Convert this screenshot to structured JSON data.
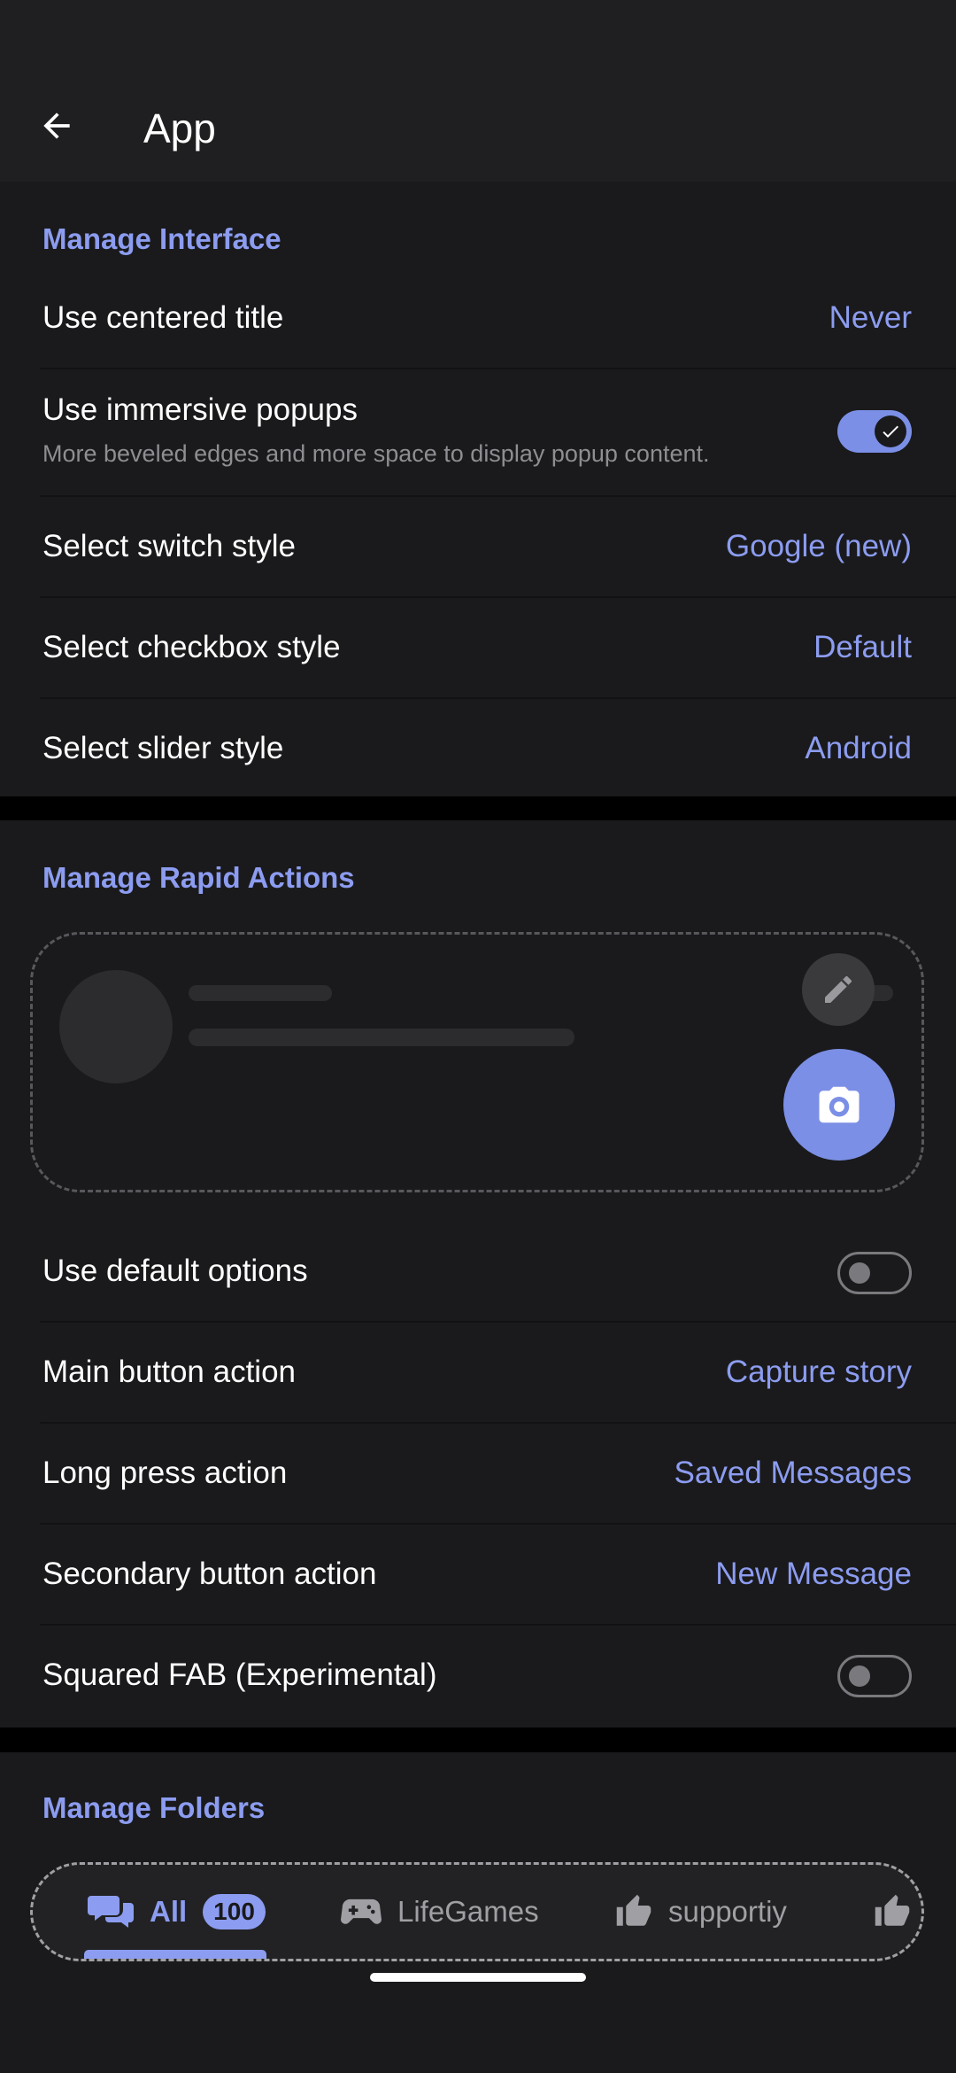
{
  "appbar": {
    "title": "App",
    "back_icon": "arrow-left-icon"
  },
  "manage_interface": {
    "header": "Manage Interface",
    "rows": [
      {
        "label": "Use centered title",
        "value": "Never"
      },
      {
        "label": "Use immersive popups",
        "subtitle": "More beveled edges and more space to display popup content.",
        "toggle": true
      },
      {
        "label": "Select switch style",
        "value": "Google (new)"
      },
      {
        "label": "Select checkbox style",
        "value": "Default"
      },
      {
        "label": "Select slider style",
        "value": "Android"
      }
    ]
  },
  "manage_rapid_actions": {
    "header": "Manage Rapid Actions",
    "preview": {
      "edit_icon": "pencil-icon",
      "main_fab_icon": "camera-icon"
    },
    "rows": [
      {
        "label": "Use default options",
        "toggle": false
      },
      {
        "label": "Main button action",
        "value": "Capture story"
      },
      {
        "label": "Long press action",
        "value": "Saved Messages"
      },
      {
        "label": "Secondary button action",
        "value": "New Message"
      },
      {
        "label": "Squared FAB (Experimental)",
        "toggle": false
      }
    ]
  },
  "manage_folders": {
    "header": "Manage Folders",
    "tabs": [
      {
        "label": "All",
        "badge": "100",
        "icon": "chat-bubbles-icon",
        "selected": true
      },
      {
        "label": "LifeGames",
        "icon": "gamepad-icon"
      },
      {
        "label": "supportiy",
        "icon": "thumbs-up-icon"
      },
      {
        "label": "",
        "icon": "thumbs-up-icon"
      }
    ]
  },
  "colors": {
    "accent": "#8c9cf0",
    "toggle_on": "#7b8fe6",
    "background": "#1a1a1c",
    "appbar": "#1f1f21"
  }
}
